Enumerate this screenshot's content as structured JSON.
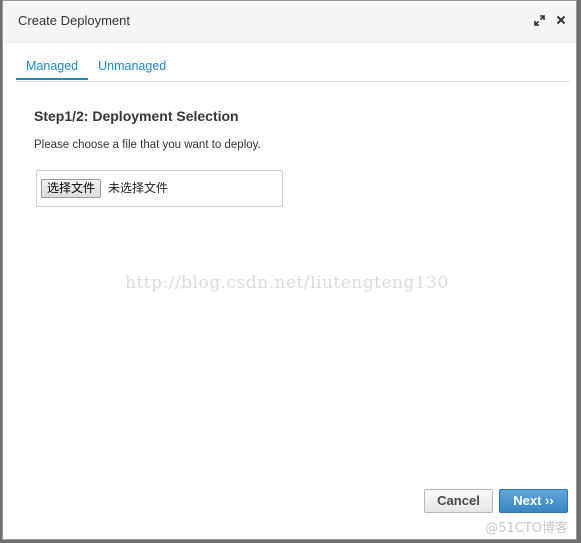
{
  "dialog": {
    "title": "Create Deployment",
    "icons": [
      "expand-icon",
      "close-icon"
    ]
  },
  "tabs": [
    {
      "label": "Managed",
      "active": true
    },
    {
      "label": "Unmanaged",
      "active": false
    }
  ],
  "step": {
    "title": "Step1/2: Deployment Selection",
    "instructions": "Please choose a file that you want to deploy."
  },
  "file_input": {
    "button_label": "选择文件",
    "status": "未选择文件"
  },
  "watermark": "http://blog.csdn.net/liutengteng130",
  "footer": {
    "cancel_label": "Cancel",
    "next_label": "Next ››"
  },
  "corner_mark": "@51CTO博客",
  "colors": {
    "accent": "#1c8bc3",
    "next_button": "#3a86c4"
  }
}
